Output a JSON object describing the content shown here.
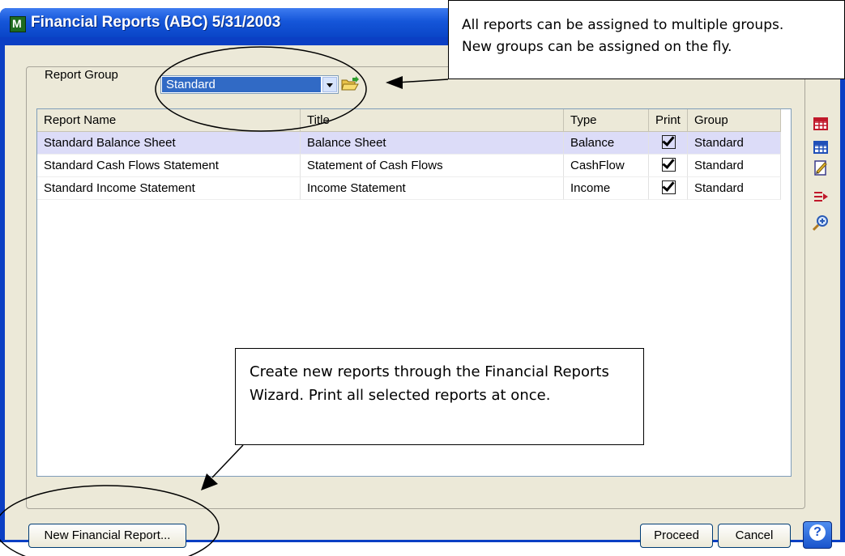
{
  "window": {
    "title": "Financial Reports (ABC) 5/31/2003",
    "icon": "app-m-icon"
  },
  "report_group": {
    "label": "Report Group",
    "selected": "Standard",
    "folder_icon": "open-folder-icon"
  },
  "table": {
    "columns": [
      "Report Name",
      "Title",
      "Type",
      "Print",
      "Group"
    ],
    "rows": [
      {
        "name": "Standard Balance Sheet",
        "title": "Balance Sheet",
        "type": "Balance",
        "print": true,
        "group": "Standard",
        "selected": true
      },
      {
        "name": "Standard Cash Flows Statement",
        "title": "Statement of Cash Flows",
        "type": "CashFlow",
        "print": true,
        "group": "Standard",
        "selected": false
      },
      {
        "name": "Standard Income Statement",
        "title": "Income Statement",
        "type": "Income",
        "print": true,
        "group": "Standard",
        "selected": false
      }
    ]
  },
  "toolbar_icons": [
    "red-grid-icon",
    "blue-grid-icon",
    "edit-document-icon",
    "print-arrow-icon",
    "zoom-in-icon"
  ],
  "buttons": {
    "new_report": "New Financial Report...",
    "proceed": "Proceed",
    "cancel": "Cancel",
    "help": "?"
  },
  "callouts": {
    "top_line1": "All reports can be assigned to multiple groups.",
    "top_line2": "New groups can be assigned on the fly.",
    "middle": "Create new reports through the Financial Reports Wizard. Print all selected reports at once."
  },
  "colors": {
    "titlebar": "#0b3fc4",
    "selection": "#316ac5",
    "dialog_bg": "#ece9d8",
    "row_highlight": "#dcdcf8"
  }
}
